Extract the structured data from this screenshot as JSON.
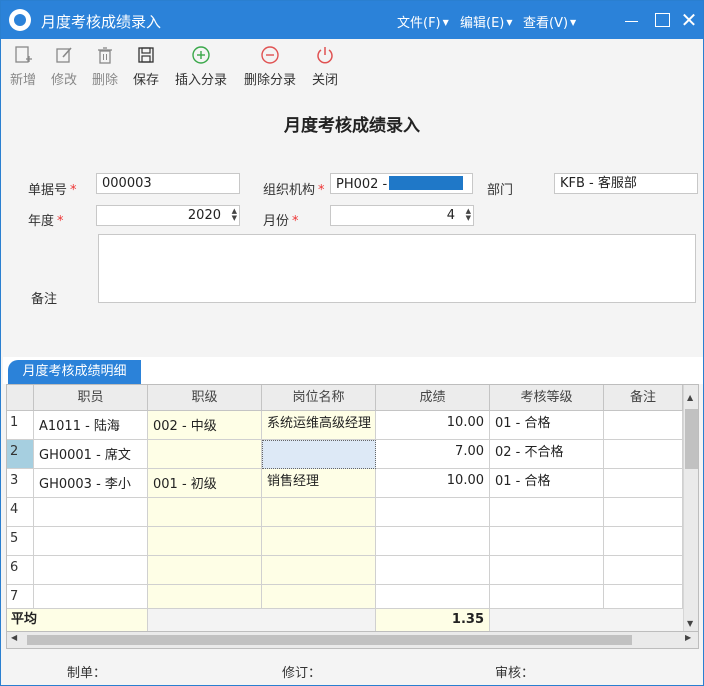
{
  "window": {
    "title": "月度考核成绩录入",
    "menus": [
      {
        "label": "文件(F)"
      },
      {
        "label": "编辑(E)"
      },
      {
        "label": "查看(V)"
      }
    ]
  },
  "toolbar": {
    "items": [
      {
        "label": "新增",
        "icon": "add-doc-icon"
      },
      {
        "label": "修改",
        "icon": "edit-icon"
      },
      {
        "label": "删除",
        "icon": "trash-icon"
      },
      {
        "label": "保存",
        "icon": "save-icon"
      },
      {
        "label": "插入分录",
        "icon": "plus-circle-icon"
      },
      {
        "label": "删除分录",
        "icon": "minus-circle-icon"
      },
      {
        "label": "关闭",
        "icon": "power-icon"
      }
    ]
  },
  "form": {
    "title": "月度考核成绩录入",
    "doc_no_label": "单据号",
    "doc_no_value": "000003",
    "org_label": "组织机构",
    "org_value": "PH002 -",
    "dept_label": "部门",
    "dept_value": "KFB - 客服部",
    "year_label": "年度",
    "year_value": "2020",
    "month_label": "月份",
    "month_value": "4",
    "remark_label": "备注",
    "remark_value": ""
  },
  "detail": {
    "tab_label": "月度考核成绩明细",
    "columns": [
      "职员",
      "职级",
      "岗位名称",
      "成绩",
      "考核等级",
      "备注"
    ],
    "rows": [
      {
        "no": "1",
        "employee": "A1011 - 陆海",
        "level": "002 - 中级",
        "post": "系统运维高级经理",
        "score": "10.00",
        "grade": "01 - 合格",
        "remark": ""
      },
      {
        "no": "2",
        "employee": "GH0001 - 席文",
        "level": "",
        "post": "",
        "score": "7.00",
        "grade": "02 - 不合格",
        "remark": ""
      },
      {
        "no": "3",
        "employee": "GH0003 - 李小",
        "level": "001 - 初级",
        "post": "销售经理",
        "score": "10.00",
        "grade": "01 - 合格",
        "remark": ""
      },
      {
        "no": "4",
        "employee": "",
        "level": "",
        "post": "",
        "score": "",
        "grade": "",
        "remark": ""
      },
      {
        "no": "5",
        "employee": "",
        "level": "",
        "post": "",
        "score": "",
        "grade": "",
        "remark": ""
      },
      {
        "no": "6",
        "employee": "",
        "level": "",
        "post": "",
        "score": "",
        "grade": "",
        "remark": ""
      },
      {
        "no": "7",
        "employee": "",
        "level": "",
        "post": "",
        "score": "",
        "grade": "",
        "remark": ""
      }
    ],
    "footer_label": "平均",
    "footer_score": "1.35"
  },
  "footer": {
    "maker_label": "制单：",
    "modifier_label": "修订：",
    "auditor_label": "审核："
  },
  "colors": {
    "title_bar": "#2b82d9",
    "editable_cell": "#fefee6",
    "selected_row": "#a6cfe0",
    "required_mark": "#e33"
  }
}
